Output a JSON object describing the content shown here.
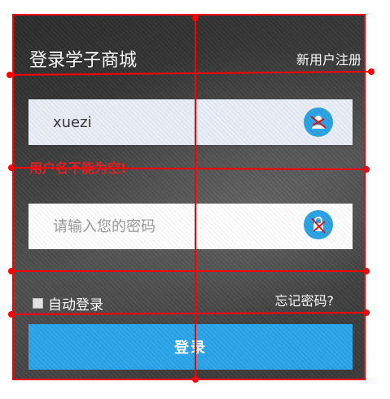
{
  "header": {
    "title": "登录学子商城",
    "register_link": "新用户注册"
  },
  "form": {
    "username_value": "xuezi",
    "username_error": "用户名不能为空!",
    "password_placeholder": "请输入您的密码",
    "remember_label": "自动登录",
    "forget_link": "忘记密码?",
    "login_button": "登录"
  },
  "icons": {
    "user": "user-icon",
    "lock": "lock-icon"
  },
  "colors": {
    "accent": "#2aa5ea",
    "error": "#e02020",
    "annotation": "#ff0000"
  }
}
